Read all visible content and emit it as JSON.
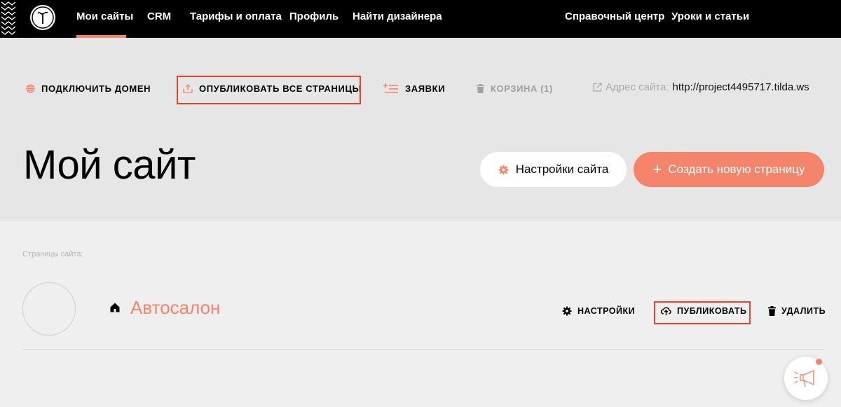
{
  "nav": {
    "items": [
      {
        "label": "Мои сайты",
        "active": true
      },
      {
        "label": "CRM"
      },
      {
        "label": "Тарифы и оплата"
      },
      {
        "label": "Профиль"
      },
      {
        "label": "Найти дизайнера"
      }
    ],
    "right_items": [
      {
        "label": "Справочный центр"
      },
      {
        "label": "Уроки и статьи"
      }
    ]
  },
  "toolbar": {
    "connect_domain": "ПОДКЛЮЧИТЬ ДОМЕН",
    "publish_all": "ОПУБЛИКОВАТЬ ВСЕ СТРАНИЦЫ",
    "leads": "ЗАЯВКИ",
    "trash": "КОРЗИНА (1)",
    "address_label": "Адрес сайта:",
    "address_url": "http://project4495717.tilda.ws"
  },
  "site": {
    "title": "Мой сайт",
    "settings_button": "Настройки сайта",
    "create_button": "Создать новую страницу"
  },
  "pages": {
    "section_label": "Страницы сайта:",
    "items": [
      {
        "title": "Автосалон",
        "settings": "НАСТРОЙКИ",
        "publish": "ПУБЛИКОВАТЬ",
        "delete": "УДАЛИТЬ"
      }
    ]
  },
  "colors": {
    "accent": "#f4846a",
    "highlight": "#e2452b",
    "topbar": "#000000",
    "header_bg": "#e6e6e6",
    "body_bg": "#efefef"
  }
}
